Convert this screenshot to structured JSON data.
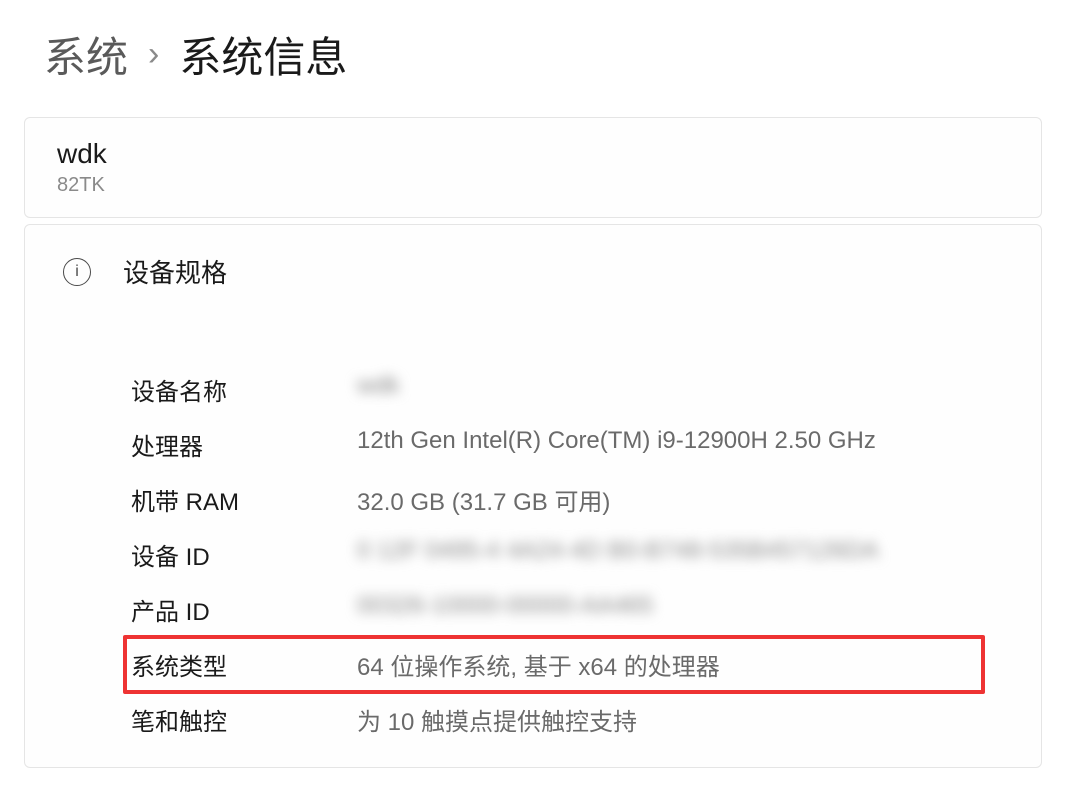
{
  "breadcrumb": {
    "parent": "系统",
    "current": "系统信息"
  },
  "device": {
    "name": "wdk",
    "model": "82TK"
  },
  "specs_section_title": "设备规格",
  "specs": [
    {
      "label": "设备名称",
      "value": "wdk",
      "blurred": true,
      "highlighted": false
    },
    {
      "label": "处理器",
      "value": "12th Gen Intel(R) Core(TM) i9-12900H   2.50 GHz",
      "blurred": false,
      "highlighted": false
    },
    {
      "label": "机带 RAM",
      "value": "32.0 GB (31.7 GB 可用)",
      "blurred": false,
      "highlighted": false
    },
    {
      "label": "设备 ID",
      "value": "0 12F 0495-4 4A24-4D B0-B748-535B457126DA",
      "blurred": true,
      "highlighted": false
    },
    {
      "label": "产品 ID",
      "value": "00326-10000-00000-AA465",
      "blurred": true,
      "highlighted": false
    },
    {
      "label": "系统类型",
      "value": "64 位操作系统, 基于 x64 的处理器",
      "blurred": false,
      "highlighted": true
    },
    {
      "label": "笔和触控",
      "value": "为 10 触摸点提供触控支持",
      "blurred": false,
      "highlighted": false
    }
  ]
}
